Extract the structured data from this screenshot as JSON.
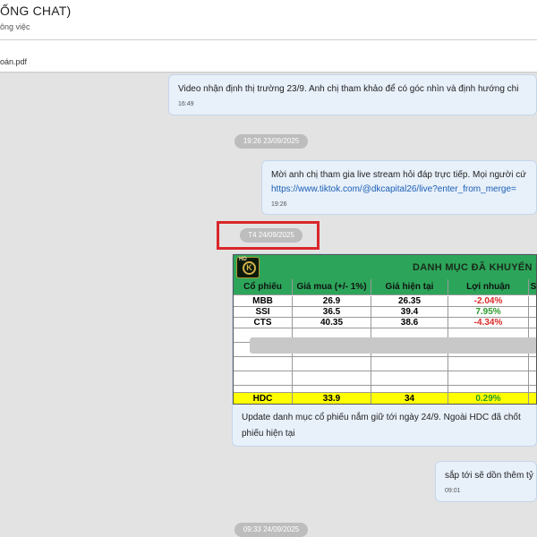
{
  "header": {
    "title": "ỐNG CHAT)",
    "subtitle": "ông việc"
  },
  "attachment": {
    "name": "oán.pdf"
  },
  "messages": [
    {
      "text": "Video nhận định thị trường 23/9. Anh chị tham khảo để có góc nhìn và định hướng chi",
      "time": "16:49"
    },
    {
      "line1": "Mời anh chị tham gia live stream hỏi đáp trực tiếp. Mọi người cứ",
      "link": "https://www.tiktok.com/@dkcapital26/live?enter_from_merge=",
      "time": "19:26"
    },
    {
      "line1": "Update danh mục cổ phiếu nắm giữ tới ngày 24/9. Ngoài HDC đã chốt",
      "line2": "phiếu hiện tại"
    },
    {
      "text": "sắp tới sẽ dồn thêm tỷ",
      "time": "09:01"
    }
  ],
  "date_separators": [
    "19:26 23/09/2025",
    "T4 24/09/2025",
    "09:33 24/09/2025"
  ],
  "table": {
    "logo_text": "HD",
    "logo_letter": "K",
    "title": "DANH MỤC ĐÃ KHUYẾN NG",
    "columns": [
      "Cổ phiếu",
      "Giá mua (+/- 1%)",
      "Giá hiện tại",
      "Lợi nhuận",
      "S"
    ],
    "rows": [
      {
        "ticker": "MBB",
        "buy": "26.9",
        "current": "26.35",
        "profit": "-2.04%"
      },
      {
        "ticker": "SSI",
        "buy": "36.5",
        "current": "39.4",
        "profit": "7.95%"
      },
      {
        "ticker": "CTS",
        "buy": "40.35",
        "current": "38.6",
        "profit": "-4.34%"
      }
    ],
    "highlight": {
      "ticker": "HDC",
      "buy": "33.9",
      "current": "34",
      "profit": "0.29%"
    }
  }
}
